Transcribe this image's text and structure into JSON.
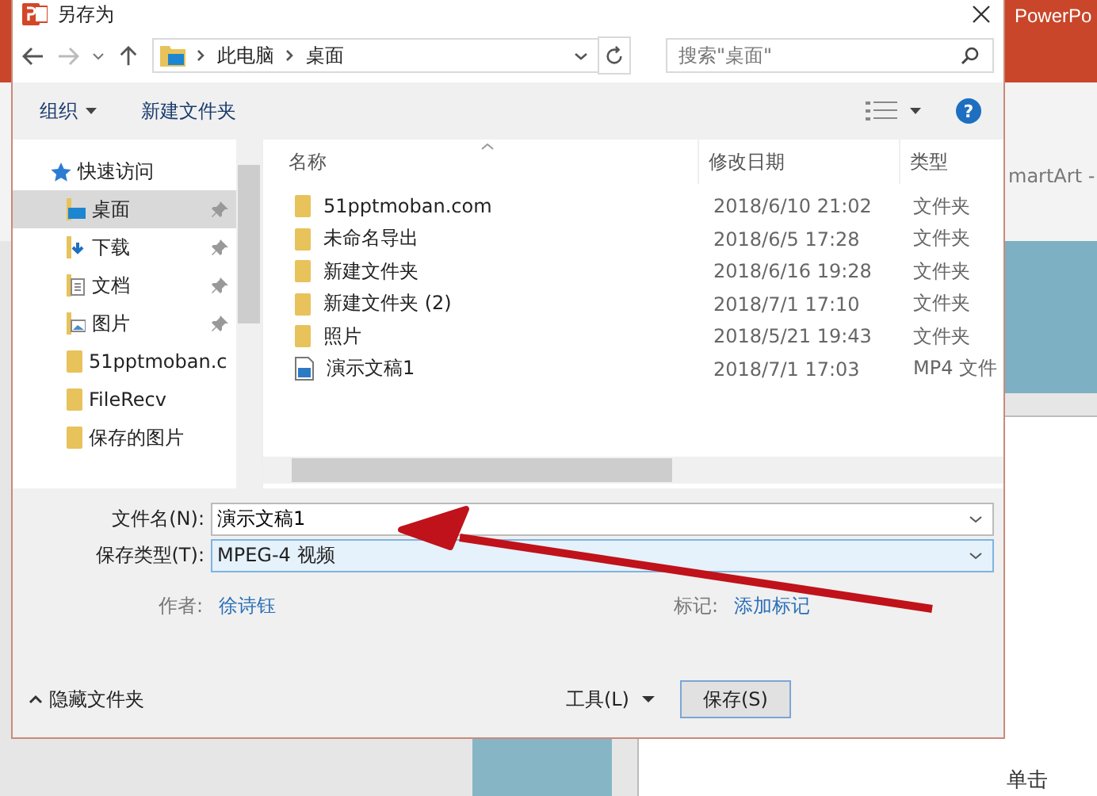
{
  "background_app": {
    "title": "PowerPo",
    "ribbon_text": "martArt -",
    "slide_text": "单击"
  },
  "dialog": {
    "title": "另存为",
    "breadcrumb": [
      "此电脑",
      "桌面"
    ],
    "search": {
      "placeholder": "搜索\"桌面\""
    },
    "toolbar": {
      "organize": "组织",
      "new_folder": "新建文件夹",
      "help": "?"
    },
    "sidebar": {
      "items": [
        {
          "label": "快速访问",
          "kind": "star",
          "selected": false,
          "pinned": false,
          "children": [
            {
              "label": "桌面",
              "kind": "desktop",
              "selected": true,
              "pinned": true
            },
            {
              "label": "下载",
              "kind": "download",
              "selected": false,
              "pinned": true
            },
            {
              "label": "文档",
              "kind": "document",
              "selected": false,
              "pinned": true
            },
            {
              "label": "图片",
              "kind": "picture",
              "selected": false,
              "pinned": true
            },
            {
              "label": "51pptmoban.c",
              "kind": "folder",
              "selected": false,
              "pinned": false
            },
            {
              "label": "FileRecv",
              "kind": "folder",
              "selected": false,
              "pinned": false
            },
            {
              "label": "保存的图片",
              "kind": "folder",
              "selected": false,
              "pinned": false
            }
          ]
        }
      ]
    },
    "table": {
      "columns": [
        "名称",
        "修改日期",
        "类型"
      ],
      "rows": [
        {
          "name": "51pptmoban.com",
          "date": "2018/6/10 21:02",
          "type": "文件夹",
          "kind": "folder"
        },
        {
          "name": "未命名导出",
          "date": "2018/6/5 17:28",
          "type": "文件夹",
          "kind": "folder"
        },
        {
          "name": "新建文件夹",
          "date": "2018/6/16 19:28",
          "type": "文件夹",
          "kind": "folder"
        },
        {
          "name": "新建文件夹 (2)",
          "date": "2018/7/1 17:10",
          "type": "文件夹",
          "kind": "folder"
        },
        {
          "name": "照片",
          "date": "2018/5/21 19:43",
          "type": "文件夹",
          "kind": "folder"
        },
        {
          "name": "演示文稿1",
          "date": "2018/7/1 17:03",
          "type": "MP4 文件",
          "kind": "video"
        }
      ]
    },
    "file_name": {
      "label": "文件名(N):",
      "value": "演示文稿1"
    },
    "save_type": {
      "label": "保存类型(T):",
      "value": "MPEG-4 视频",
      "selected": true
    },
    "author": {
      "label": "作者:",
      "value": "徐诗钰"
    },
    "tags": {
      "label": "标记:",
      "value": "添加标记"
    },
    "hide_folders": "隐藏文件夹",
    "tools": "工具(L)",
    "save": "保存(S)"
  }
}
